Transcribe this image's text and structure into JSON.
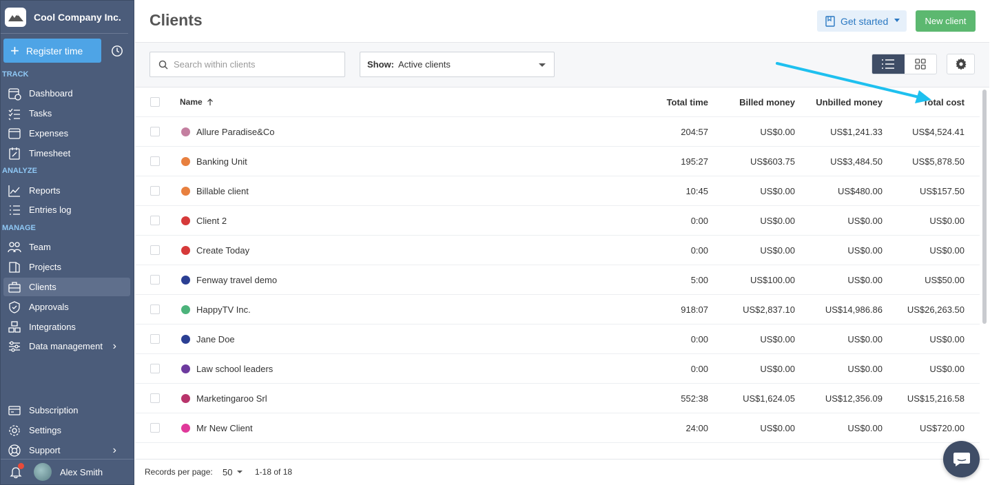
{
  "company": "Cool Company Inc.",
  "register_label": "Register time",
  "sections": {
    "track": "TRACK",
    "analyze": "ANALYZE",
    "manage": "MANAGE"
  },
  "nav": {
    "dashboard": "Dashboard",
    "tasks": "Tasks",
    "expenses": "Expenses",
    "timesheet": "Timesheet",
    "reports": "Reports",
    "entries_log": "Entries log",
    "team": "Team",
    "projects": "Projects",
    "clients": "Clients",
    "approvals": "Approvals",
    "integrations": "Integrations",
    "data_management": "Data management",
    "subscription": "Subscription",
    "settings": "Settings",
    "support": "Support"
  },
  "user_name": "Alex Smith",
  "page_title": "Clients",
  "get_started_label": "Get started",
  "new_client_label": "New client",
  "search_placeholder": "Search within clients",
  "show_label": "Show:",
  "show_value": "Active clients",
  "columns": {
    "name": "Name",
    "total_time": "Total time",
    "billed": "Billed money",
    "unbilled": "Unbilled money",
    "total_cost": "Total cost"
  },
  "rows": [
    {
      "name": "Allure Paradise&Co",
      "color": "#c47fa0",
      "time": "204:57",
      "billed": "US$0.00",
      "unbilled": "US$1,241.33",
      "cost": "US$4,524.41"
    },
    {
      "name": "Banking Unit",
      "color": "#e8803f",
      "time": "195:27",
      "billed": "US$603.75",
      "unbilled": "US$3,484.50",
      "cost": "US$5,878.50"
    },
    {
      "name": "Billable client",
      "color": "#e8803f",
      "time": "10:45",
      "billed": "US$0.00",
      "unbilled": "US$480.00",
      "cost": "US$157.50"
    },
    {
      "name": "Client 2",
      "color": "#d63a3a",
      "time": "0:00",
      "billed": "US$0.00",
      "unbilled": "US$0.00",
      "cost": "US$0.00"
    },
    {
      "name": "Create Today",
      "color": "#d63a3a",
      "time": "0:00",
      "billed": "US$0.00",
      "unbilled": "US$0.00",
      "cost": "US$0.00"
    },
    {
      "name": "Fenway travel demo",
      "color": "#2b3f93",
      "time": "5:00",
      "billed": "US$100.00",
      "unbilled": "US$0.00",
      "cost": "US$50.00"
    },
    {
      "name": "HappyTV Inc.",
      "color": "#4cb37b",
      "time": "918:07",
      "billed": "US$2,837.10",
      "unbilled": "US$14,986.86",
      "cost": "US$26,263.50"
    },
    {
      "name": "Jane Doe",
      "color": "#2b3f93",
      "time": "0:00",
      "billed": "US$0.00",
      "unbilled": "US$0.00",
      "cost": "US$0.00"
    },
    {
      "name": "Law school leaders",
      "color": "#6d3a9e",
      "time": "0:00",
      "billed": "US$0.00",
      "unbilled": "US$0.00",
      "cost": "US$0.00"
    },
    {
      "name": "Marketingaroo Srl",
      "color": "#b8346b",
      "time": "552:38",
      "billed": "US$1,624.05",
      "unbilled": "US$12,356.09",
      "cost": "US$15,216.58"
    },
    {
      "name": "Mr New Client",
      "color": "#e0399a",
      "time": "24:00",
      "billed": "US$0.00",
      "unbilled": "US$0.00",
      "cost": "US$720.00"
    }
  ],
  "footer": {
    "records_label": "Records per page:",
    "per_page": "50",
    "range": "1-18 of 18"
  }
}
